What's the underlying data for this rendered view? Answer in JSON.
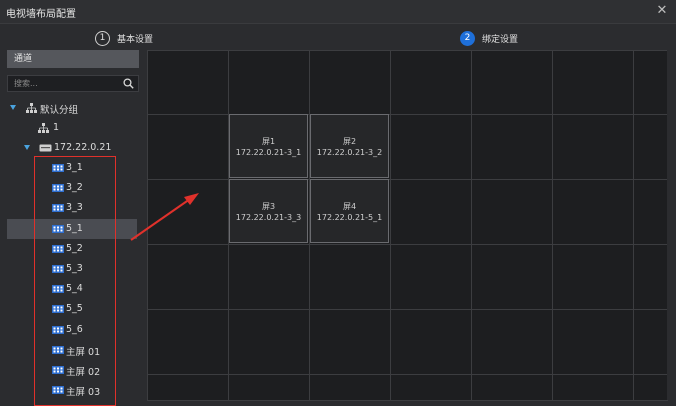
{
  "window": {
    "title": "电视墙布局配置",
    "close_glyph": "✕"
  },
  "steps": [
    {
      "number": "1",
      "label": "基本设置",
      "active": false
    },
    {
      "number": "2",
      "label": "绑定设置",
      "active": true
    }
  ],
  "left_panel": {
    "header": "通道",
    "search": {
      "placeholder": "搜索...",
      "value": ""
    },
    "tree": {
      "group": {
        "label": "默认分组",
        "expanded": true
      },
      "node_1": {
        "label": "1"
      },
      "device": {
        "label": "172.22.0.21",
        "expanded": true
      },
      "channels": [
        "3_1",
        "3_2",
        "3_3",
        "5_1",
        "5_2",
        "5_3",
        "5_4",
        "5_5",
        "5_6",
        "主屏 01",
        "主屏 02",
        "主屏 03"
      ],
      "selected_channel": "5_1"
    }
  },
  "screens": [
    {
      "name": "屏1",
      "device": "172.22.0.21-3_1"
    },
    {
      "name": "屏2",
      "device": "172.22.0.21-3_2"
    },
    {
      "name": "屏3",
      "device": "172.22.0.21-3_3"
    },
    {
      "name": "屏4",
      "device": "172.22.0.21-5_1"
    }
  ],
  "colors": {
    "accent": "#1e6fd9",
    "highlight_box": "#e0312b",
    "tree_caret": "#4aa3df",
    "background": "#2b2c2f",
    "grid_background": "#1d1e20"
  },
  "icons": {
    "channel": "camera-channel-icon",
    "device": "dvr-device-icon",
    "group": "org-tree-icon",
    "search": "search-icon",
    "close": "close-icon"
  }
}
